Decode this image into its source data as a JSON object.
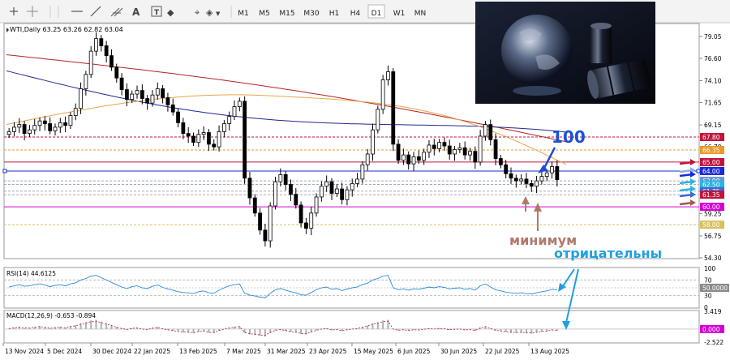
{
  "toolbar": {
    "timeframes": [
      "M1",
      "M5",
      "M15",
      "M30",
      "H1",
      "H4",
      "D1",
      "W1",
      "MN"
    ],
    "active_timeframe": "D1",
    "icons": [
      "crosshair-icon",
      "cursor-icon",
      "horizontal-line-icon",
      "trendline-icon",
      "channel-icon",
      "text-tool-icon",
      "text-label-icon",
      "shapes-icon"
    ]
  },
  "colors": {
    "candle": "#000000",
    "ma_fast": "#e8a54b",
    "ma_mid": "#1f2a8a",
    "ma_slow": "#b52424",
    "level_red": "#c0143c",
    "level_magenta": "#d400d4",
    "level_blue": "#1a2ad6",
    "level_orange": "#e89a2a",
    "rsi_line": "#2a8ad4",
    "annotation_blue": "#1e4fd6",
    "annotation_brown": "#b07a6a",
    "annotation_cyan": "#1ea0e0"
  },
  "chart_data": [
    {
      "type": "candlestick",
      "title": "WTI,Daily  63.25 63.26 62.82 63.04",
      "instrument": "WTI",
      "timeframe": "Daily",
      "ohlc_last": {
        "open": 63.25,
        "high": 63.26,
        "low": 62.82,
        "close": 63.04
      },
      "ylim": [
        54.3,
        80.4
      ],
      "y_ticks": [
        79.05,
        76.6,
        74.1,
        71.65,
        69.15,
        66.7,
        64.2,
        61.75,
        59.25,
        56.75,
        54.3
      ],
      "x_ticks": [
        "13 Nov 2024",
        "5 Dec 2024",
        "30 Dec 2024",
        "22 Jan 2025",
        "13 Feb 2025",
        "7 Mar 2025",
        "31 Mar 2025",
        "23 Apr 2025",
        "15 May 2025",
        "6 Jun 2025",
        "30 Jun 2025",
        "22 Jul 2025",
        "13 Aug 2025"
      ],
      "close_series": [
        68.4,
        68.9,
        69.2,
        68.2,
        68.6,
        69.1,
        69.6,
        69.3,
        68.5,
        68.9,
        69.4,
        69.1,
        70.2,
        71.0,
        73.2,
        74.8,
        77.4,
        78.8,
        78.0,
        76.9,
        75.6,
        74.4,
        73.1,
        72.0,
        72.6,
        73.0,
        72.1,
        71.6,
        72.5,
        73.2,
        72.2,
        71.4,
        70.6,
        69.4,
        68.2,
        67.9,
        67.2,
        68.1,
        68.3,
        67.0,
        66.7,
        68.4,
        69.3,
        70.1,
        71.2,
        71.8,
        63.2,
        61.0,
        59.3,
        57.4,
        56.2,
        60.1,
        62.8,
        63.6,
        62.5,
        61.4,
        60.2,
        58.2,
        57.6,
        59.3,
        61.1,
        62.3,
        62.8,
        61.5,
        62.0,
        60.8,
        61.9,
        62.6,
        63.1,
        64.7,
        65.9,
        68.6,
        70.9,
        74.2,
        75.1,
        67.0,
        65.2,
        65.8,
        64.8,
        65.6,
        65.2,
        66.1,
        66.9,
        66.5,
        67.2,
        66.8,
        65.9,
        66.4,
        66.6,
        65.8,
        66.2,
        65.0,
        67.9,
        69.2,
        67.5,
        65.4,
        64.7,
        63.7,
        63.2,
        62.9,
        63.1,
        62.6,
        62.3,
        62.9,
        63.4,
        63.8,
        64.5,
        63.04
      ],
      "moving_averages": [
        {
          "role": "fast",
          "start": 69.2,
          "end": 66.7
        },
        {
          "role": "mid",
          "label": "100",
          "start": 75.2,
          "end": 64.0
        },
        {
          "role": "slow",
          "start": 77.0,
          "end": 66.9
        }
      ],
      "price_labels": [
        {
          "text": "67.80",
          "value": 67.8,
          "color": "#c0143c"
        },
        {
          "text": "66.35",
          "value": 66.35,
          "color": "#e89a2a"
        },
        {
          "text": "65.00",
          "value": 65.0,
          "color": "#c0143c"
        },
        {
          "text": "64.00",
          "value": 64.0,
          "color": "#1a2ad6"
        },
        {
          "text": "62.90",
          "value": 62.9,
          "color": "#6a96d8"
        },
        {
          "text": "62.50",
          "value": 62.5,
          "color": "#2ab4e0"
        },
        {
          "text": "61.75",
          "value": 61.75,
          "color": "#3a6ad8"
        },
        {
          "text": "61.35",
          "value": 61.35,
          "color": "#c0143c"
        },
        {
          "text": "60.00",
          "value": 60.0,
          "color": "#d400d4"
        },
        {
          "text": "58.00",
          "value": 58.0,
          "color": "#d8c060"
        }
      ],
      "horizontal_levels": [
        {
          "value": 67.8,
          "color": "#c0143c",
          "dashed": true
        },
        {
          "value": 66.35,
          "color": "#e89a2a",
          "dashed": true
        },
        {
          "value": 65.0,
          "color": "#c0143c",
          "dashed": false
        },
        {
          "value": 64.0,
          "color": "#1a2ad6",
          "dashed": false
        },
        {
          "value": 62.9,
          "color": "#a0a8c0",
          "dashed": true
        },
        {
          "value": 62.5,
          "color": "#a0a8c0",
          "dashed": true
        },
        {
          "value": 61.75,
          "color": "#a0a8c0",
          "dashed": true
        },
        {
          "value": 61.35,
          "color": "#a0a8c0",
          "dashed": true
        },
        {
          "value": 60.0,
          "color": "#d400d4",
          "dashed": false
        },
        {
          "value": 58.0,
          "color": "#d8c060",
          "dashed": true
        }
      ],
      "annotations": [
        {
          "text": "100",
          "color": "#1e4fd6"
        },
        {
          "text": "минимум",
          "color": "#b07a6a"
        },
        {
          "text": "отрицательны",
          "color": "#1ea0e0"
        }
      ]
    },
    {
      "type": "line",
      "title": "RSI(14) 44.6125",
      "indicator": "RSI",
      "period": 14,
      "last_value": 44.6125,
      "ylim": [
        0,
        100
      ],
      "y_ticks": [
        100,
        70,
        30,
        0
      ],
      "levels": [
        70,
        30
      ],
      "current_label": "50.0000",
      "values": [
        52,
        55,
        58,
        54,
        55,
        58,
        60,
        57,
        53,
        56,
        58,
        55,
        60,
        63,
        70,
        74,
        80,
        82,
        76,
        70,
        64,
        58,
        52,
        48,
        53,
        55,
        50,
        48,
        54,
        57,
        51,
        47,
        44,
        40,
        38,
        37,
        35,
        40,
        42,
        37,
        36,
        44,
        50,
        55,
        58,
        60,
        36,
        31,
        29,
        26,
        24,
        36,
        45,
        48,
        44,
        40,
        37,
        32,
        31,
        38,
        45,
        50,
        52,
        46,
        48,
        43,
        47,
        50,
        52,
        58,
        62,
        70,
        74,
        80,
        82,
        50,
        45,
        47,
        44,
        47,
        46,
        49,
        52,
        50,
        53,
        51,
        47,
        49,
        50,
        46,
        48,
        44,
        55,
        60,
        52,
        45,
        42,
        39,
        37,
        36,
        37,
        35,
        34,
        37,
        40,
        42,
        46,
        44.6125
      ]
    },
    {
      "type": "bar",
      "title": "MACD(12,26,9) -0.653 -0.894",
      "indicator": "MACD",
      "params": [
        12,
        26,
        9
      ],
      "macd_last": -0.653,
      "signal_last": -0.894,
      "y_ticks": [
        3.419,
        0.0,
        -2.522
      ],
      "ylim": [
        -2.522,
        3.419
      ],
      "current_label": "0.000"
    }
  ]
}
